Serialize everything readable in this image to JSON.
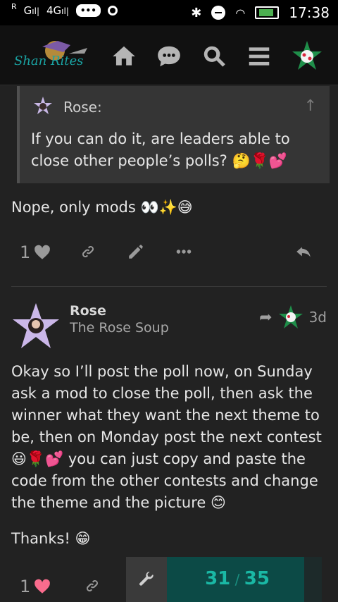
{
  "statusbar": {
    "carrier_mark": "R",
    "signal_1": "G",
    "signal_2": "4G",
    "time": "17:38"
  },
  "header": {
    "logo_text": "Shan  Rites",
    "nav": [
      "home-icon",
      "chat-icon",
      "search-icon",
      "hamburger-menu-icon"
    ]
  },
  "quote": {
    "author": "Rose:",
    "text": "If you can do it, are leaders able to close other people’s polls? 🤔🌹💕"
  },
  "reply": {
    "text": "Nope, only mods 👀✨😅",
    "like_count": "1"
  },
  "post": {
    "username": "Rose",
    "user_title": "The Rose Soup",
    "age": "3d",
    "body": "Okay so I’ll post the poll now, on Sunday ask a mod to close the poll, then ask the winner what they want the next theme to be, then on Monday post the next contest 😃🌹💕 you can just copy and paste the code from the other contests and change the theme and the picture 😊",
    "thanks": "Thanks! 😁",
    "like_count": "1"
  },
  "progress": {
    "current": "31",
    "separator": "/",
    "total": "35",
    "fraction": 0.8857
  },
  "colors": {
    "background": "#222222",
    "accent": "#1ab8a5",
    "heart_liked": "#fa6c8d"
  }
}
